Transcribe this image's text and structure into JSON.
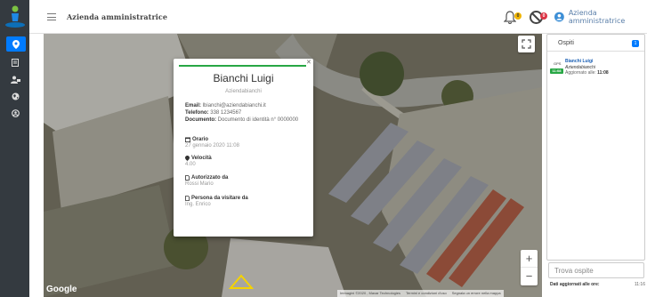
{
  "header": {
    "title": "Azienda amministratrice",
    "bell_count": "0",
    "block_count": "0",
    "user_name": "Azienda amministratrice"
  },
  "sidebar": {
    "items": [
      {
        "icon": "map-marker-icon",
        "active": true
      },
      {
        "icon": "document-icon",
        "active": false
      },
      {
        "icon": "users-icon",
        "active": false
      },
      {
        "icon": "globe-icon",
        "active": false
      },
      {
        "icon": "user-circle-icon",
        "active": false
      }
    ]
  },
  "popup": {
    "name": "Bianchi Luigi",
    "company": "Aziendabianchi",
    "email_label": "Email:",
    "email_value": "lbianchi@aziendabianchi.it",
    "phone_label": "Telefono:",
    "phone_value": "338 1234567",
    "doc_label": "Documento:",
    "doc_value": "Documento di identità n° 0000000",
    "orario_label": "Orario",
    "orario_value": "27 gennaio 2020 11:08",
    "velocita_label": "Velocità",
    "velocita_value": "4.00",
    "autorizzato_label": "Autorizzato da",
    "autorizzato_value": "Rossi Mario",
    "persona_label": "Persona da visitare da",
    "persona_value": "Ing. Enrico"
  },
  "map": {
    "google_logo": "Google",
    "attribution": [
      "Immagini ©2020 , Maxar Technologies",
      "Termini e condizioni d'uso",
      "Segnala un errore nella mappa"
    ],
    "zoom_in": "+",
    "zoom_out": "−"
  },
  "panel": {
    "title": "Ospiti",
    "count": "1",
    "guest": {
      "gps": "GPS",
      "time": "11:08",
      "name": "Bianchi Luigi",
      "company": "Aziendabianchi",
      "updated_prefix": "Aggiornato alle: ",
      "updated_time": "11:08"
    },
    "search_placeholder": "Trova ospite",
    "updated_label": "Dati aggiornati alle ore:",
    "updated_time": "11:16"
  },
  "colors": {
    "sidebar": "#343a40",
    "primary": "#007bff",
    "success": "#28a745",
    "danger": "#dc3545",
    "warning": "#f0b400"
  }
}
